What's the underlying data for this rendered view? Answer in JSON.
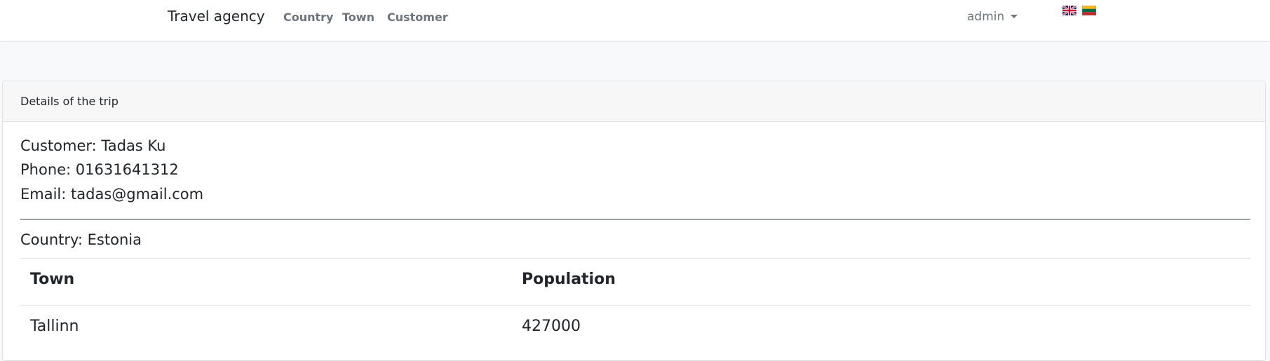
{
  "navbar": {
    "brand": "Travel agency",
    "links": [
      "Country",
      "Town",
      "Customer"
    ],
    "user": "admin",
    "languages": [
      {
        "code": "en",
        "icon": "uk-flag-icon"
      },
      {
        "code": "lt",
        "icon": "lithuania-flag-icon"
      }
    ]
  },
  "card": {
    "title": "Details of the trip",
    "customer": "Customer: Tadas Ku",
    "phone": "Phone: 01631641312",
    "email": "Email: tadas@gmail.com",
    "country": "Country: Estonia",
    "table": {
      "headers": [
        "Town",
        "Population"
      ],
      "rows": [
        [
          "Tallinn",
          "427000"
        ]
      ]
    }
  },
  "colors": {
    "page_background": "#f8f9fa",
    "navbar_background": "#ffffff",
    "card_header_background": "#f7f7f7",
    "nav_link": "#6c757d",
    "text": "#212529"
  }
}
